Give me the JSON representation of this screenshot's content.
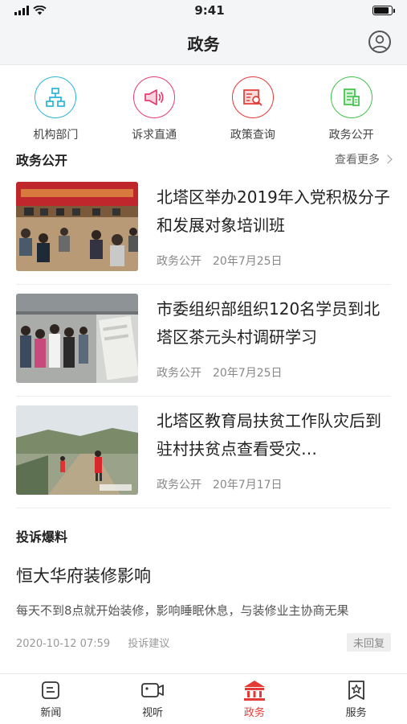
{
  "status_bar": {
    "time": "9:41"
  },
  "nav": {
    "title": "政务"
  },
  "quick_links": [
    {
      "label": "机构部门",
      "icon": "org-chart-icon",
      "color": "#2ab4d9"
    },
    {
      "label": "诉求直通",
      "icon": "megaphone-icon",
      "color": "#e53a6b"
    },
    {
      "label": "政策查询",
      "icon": "document-search-icon",
      "color": "#e53935"
    },
    {
      "label": "政务公开",
      "icon": "document-icon",
      "color": "#3fc24a"
    }
  ],
  "gov_section": {
    "title": "政务公开",
    "more_label": "查看更多"
  },
  "news": [
    {
      "title": "北塔区举办2019年入党积极分子和发展对象培训班",
      "category": "政务公开",
      "date": "20年7月25日"
    },
    {
      "title": "市委组织部组织120名学员到北塔区茶元头村调研学习",
      "category": "政务公开",
      "date": "20年7月25日"
    },
    {
      "title": "北塔区教育局扶贫工作队灾后到驻村扶贫点查看受灾…",
      "category": "政务公开",
      "date": "20年7月17日"
    }
  ],
  "complaint_section": {
    "title": "投诉爆料"
  },
  "complaint": {
    "title": "恒大华府装修影响",
    "description": "每天不到8点就开始装修，影响睡眠休息，与装修业主协商无果",
    "time": "2020-10-12 07:59",
    "type": "投诉建议",
    "status": "未回复"
  },
  "tabs": [
    {
      "label": "新闻",
      "icon": "news-icon",
      "active": false
    },
    {
      "label": "视听",
      "icon": "video-icon",
      "active": false
    },
    {
      "label": "政务",
      "icon": "government-building-icon",
      "active": true
    },
    {
      "label": "服务",
      "icon": "star-badge-icon",
      "active": false
    }
  ],
  "colors": {
    "accent": "#e53935",
    "nav_bg": "#f4f5f7"
  }
}
